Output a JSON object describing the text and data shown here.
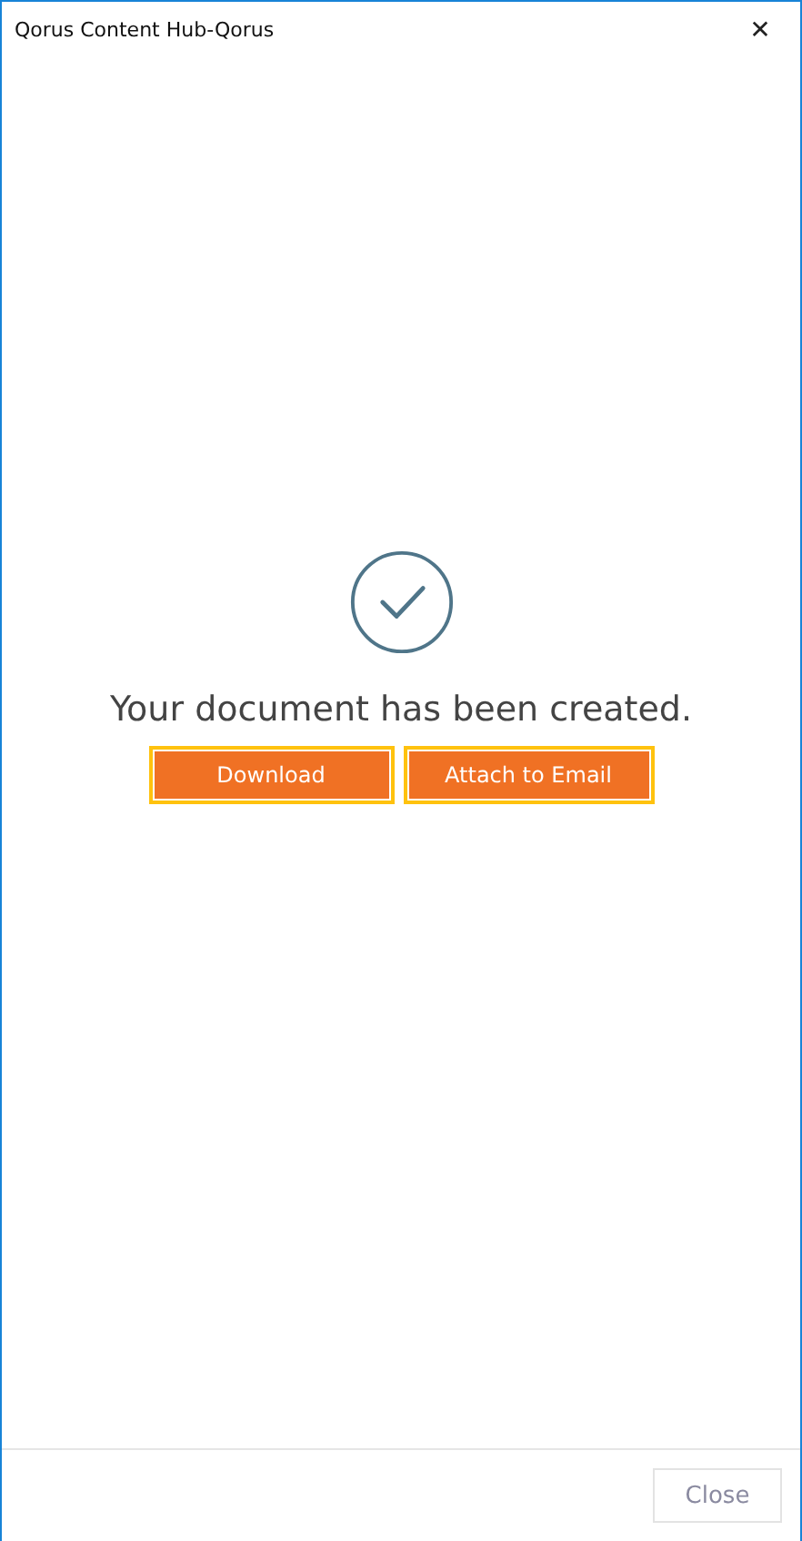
{
  "window": {
    "title": "Qorus Content Hub-Qorus",
    "close_glyph": "✕"
  },
  "message": "Your document has been created.",
  "buttons": [
    {
      "label": "Download",
      "highlighted": true
    },
    {
      "label": "Attach to Email",
      "highlighted": true
    }
  ],
  "footer": {
    "close_label": "Close"
  }
}
